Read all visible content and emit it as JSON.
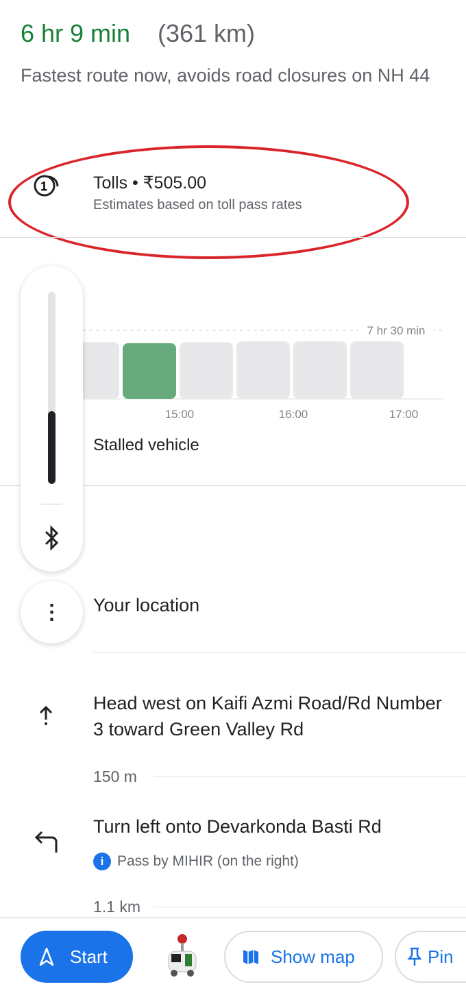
{
  "summary": {
    "duration": "6 hr 9 min",
    "distance": "(361 km)",
    "description": "Fastest route now, avoids road closures on NH 44"
  },
  "tolls": {
    "title": "Tolls • ₹505.00",
    "subtitle": "Estimates based on toll pass rates",
    "icon": "toll-icon"
  },
  "chart_data": {
    "type": "bar",
    "reference_line": {
      "label": "7 hr 30 min",
      "value_hr": 7.5
    },
    "x_ticks": [
      "15:00",
      "16:00",
      "17:00"
    ],
    "values_hr": [
      6.2,
      6.1,
      6.2,
      6.3,
      6.3,
      6.3
    ],
    "highlighted_index": 1,
    "colors": {
      "highlight": "#67aa7d",
      "default": "#e8e8ea"
    }
  },
  "incident": "Stalled vehicle",
  "zoom_control": {
    "level_percent": 38,
    "icon": "bluetooth-icon"
  },
  "steps": [
    {
      "icon": "location",
      "text": "Your location"
    },
    {
      "icon": "arrow-up",
      "text": "Head west on Kaifi Azmi Road/Rd Number 3 toward Green Valley Rd",
      "distance": "150 m"
    },
    {
      "icon": "turn-left",
      "text": "Turn left onto Devarkonda Basti Rd",
      "note": "Pass by MIHIR (on the right)",
      "distance": "1.1 km"
    }
  ],
  "actions": {
    "start": "Start",
    "show_map": "Show map",
    "pin": "Pin"
  },
  "colors": {
    "accent": "#1a73e8",
    "duration": "#188038",
    "annotation": "#d9242a"
  }
}
